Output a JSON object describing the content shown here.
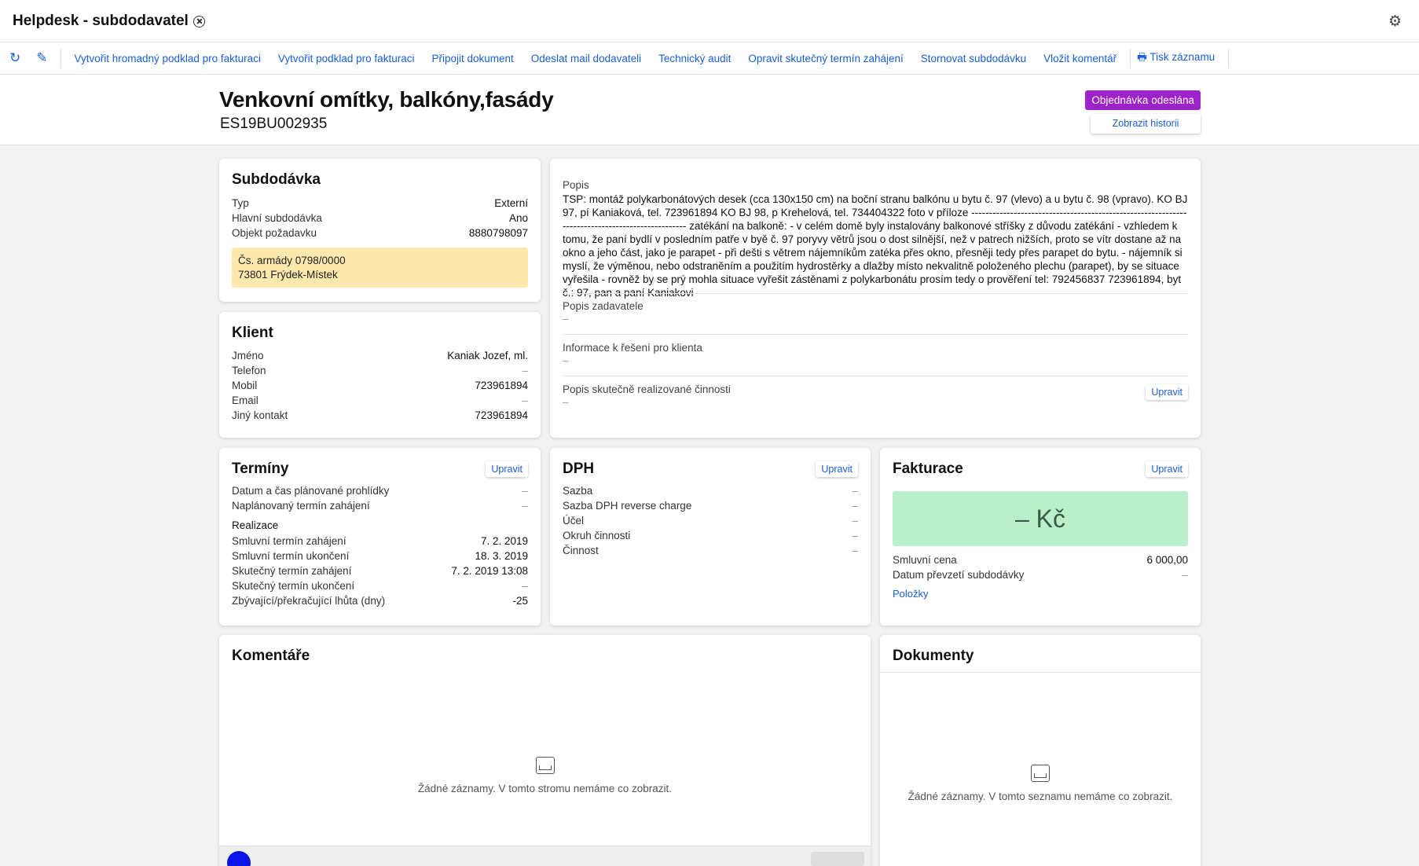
{
  "app": {
    "title": "Helpdesk - subdodavatel"
  },
  "toolbar": {
    "links": [
      "Vytvořit hromadný podklad pro fakturaci",
      "Vytvořit podklad pro fakturaci",
      "Připojit dokument",
      "Odeslat mail dodavateli",
      "Technický audit",
      "Opravit skutečný termín zahájení",
      "Stornovat subdodávku",
      "Vložit komentář"
    ],
    "print": "Tisk záznamu"
  },
  "header": {
    "title": "Venkovní omítky, balkóny,fasády",
    "code": "ES19BU002935",
    "status": "Objednávka odeslána",
    "history_button": "Zobrazit historii"
  },
  "subdodavka": {
    "title": "Subdodávka",
    "rows": [
      {
        "label": "Typ",
        "value": "Externí"
      },
      {
        "label": "Hlavní subdodávka",
        "value": "Ano"
      },
      {
        "label": "Objekt požadavku",
        "value": "8880798097"
      }
    ],
    "address_line1": "Čs. armády 0798/0000",
    "address_line2": "73801 Frýdek-Místek"
  },
  "klient": {
    "title": "Klient",
    "rows": [
      {
        "label": "Jméno",
        "value": "Kaniak Jozef, ml."
      },
      {
        "label": "Telefon",
        "value": "–"
      },
      {
        "label": "Mobil",
        "value": "723961894"
      },
      {
        "label": "Email",
        "value": "–"
      },
      {
        "label": "Jiný kontakt",
        "value": "723961894"
      }
    ]
  },
  "popis": {
    "label": "Popis",
    "text": "TSP: montáž polykarbonátových desek (cca 130x150 cm) na boční stranu balkónu u bytu č. 97 (vlevo) a u bytu č. 98 (vpravo). KO BJ 97, pí Kaniaková, tel. 723961894 KO BJ 98, p Krehelová, tel. 734404322 foto v příloze ------------------------------------------------------------------------------------------------ zatékání na balkoně: - v celém domě byly instalovány balkonové stříšky z důvodu zatékání - vzhledem k tomu, že paní bydlí v posledním patře v byě č. 97 poryvy větrů jsou o dost silnější, než v patrech nižších, proto se vítr dostane až na okno a jeho část, jako je parapet - při dešti s větrem nájemníkům zatéka přes okno, přesněji tedy přes parapet do bytu. - nájemník si myslí, že výměnou, nebo odstraněním a použitím hydrostěrky a dlažby místo nekvalitně položeného plechu (parapet), by se situace vyřešila - rovněž by se prý mohla situace vyřešit zástěnami z polykarbonátu prosím tedy o prověření tel: 792456837 723961894, byt č.: 97, pan a paní Kaniakovi",
    "zadavatel_label": "Popis zadavatele",
    "zadavatel_value": "–",
    "info_label": "Informace k řešení pro klienta",
    "info_value": "–",
    "realizace_label": "Popis skutečně realizované činnosti",
    "realizace_value": "–",
    "edit_button": "Upravit"
  },
  "terminy": {
    "title": "Termíny",
    "edit_button": "Upravit",
    "rows": [
      {
        "label": "Datum a čas plánované prohlídky",
        "value": "–"
      },
      {
        "label": "Naplánovaný termín zahájení",
        "value": "–"
      }
    ],
    "realizace_heading": "Realizace",
    "realizace_rows": [
      {
        "label": "Smluvní termín zahájení",
        "value": "7. 2. 2019"
      },
      {
        "label": "Smluvní termín ukončení",
        "value": "18. 3. 2019"
      },
      {
        "label": "Skutečný termín zahájení",
        "value": "7. 2. 2019 13:08"
      },
      {
        "label": "Skutečný termín ukončení",
        "value": "–"
      },
      {
        "label": "Zbývající/překračující lhůta (dny)",
        "value": "-25"
      }
    ]
  },
  "dph": {
    "title": "DPH",
    "edit_button": "Upravit",
    "rows": [
      {
        "label": "Sazba",
        "value": "–"
      },
      {
        "label": "Sazba DPH reverse charge",
        "value": "–"
      },
      {
        "label": "Účel",
        "value": "–"
      },
      {
        "label": "Okruh činnosti",
        "value": "–"
      },
      {
        "label": "Činnost",
        "value": "–"
      }
    ]
  },
  "fakturace": {
    "title": "Fakturace",
    "edit_button": "Upravit",
    "price": "– Kč",
    "rows": [
      {
        "label": "Smluvní cena",
        "value": "6 000,00"
      },
      {
        "label": "Datum převzetí subdodávky",
        "value": "–"
      }
    ],
    "items_link": "Položky"
  },
  "komentare": {
    "title": "Komentáře",
    "empty": "Žádné záznamy. V tomto stromu nemáme co zobrazit."
  },
  "dokumenty": {
    "title": "Dokumenty",
    "empty": "Žádné záznamy. V tomto seznamu nemáme co zobrazit."
  },
  "icons": {
    "refresh": "refresh-icon",
    "edit": "pencil-icon",
    "print": "printer-icon",
    "settings": "gear-icon",
    "close": "close-circle-icon",
    "empty": "inbox-icon"
  },
  "colors": {
    "accent": "#1a5fd6",
    "status_badge": "#9e22c9",
    "address_bg": "#fde8ad",
    "price_bg": "#b9efc9"
  }
}
